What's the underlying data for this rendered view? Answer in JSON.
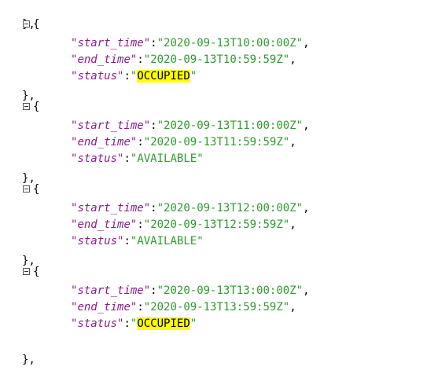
{
  "lines": {
    "first_close": "},",
    "last_close": "},"
  },
  "records": [
    {
      "start_time": "2020-09-13T10:00:00Z",
      "end_time": "2020-09-13T10:59:59Z",
      "status": "OCCUPIED",
      "highlight": true
    },
    {
      "start_time": "2020-09-13T11:00:00Z",
      "end_time": "2020-09-13T11:59:59Z",
      "status": "AVAILABLE",
      "highlight": false
    },
    {
      "start_time": "2020-09-13T12:00:00Z",
      "end_time": "2020-09-13T12:59:59Z",
      "status": "AVAILABLE",
      "highlight": false
    },
    {
      "start_time": "2020-09-13T13:00:00Z",
      "end_time": "2020-09-13T13:59:59Z",
      "status": "OCCUPIED",
      "highlight": true
    }
  ],
  "keys": {
    "start_time": "start_time",
    "end_time": "end_time",
    "status": "status"
  },
  "colors": {
    "key": "#8a1e8a",
    "string": "#2e9b2e",
    "highlight": "#ffff00"
  }
}
